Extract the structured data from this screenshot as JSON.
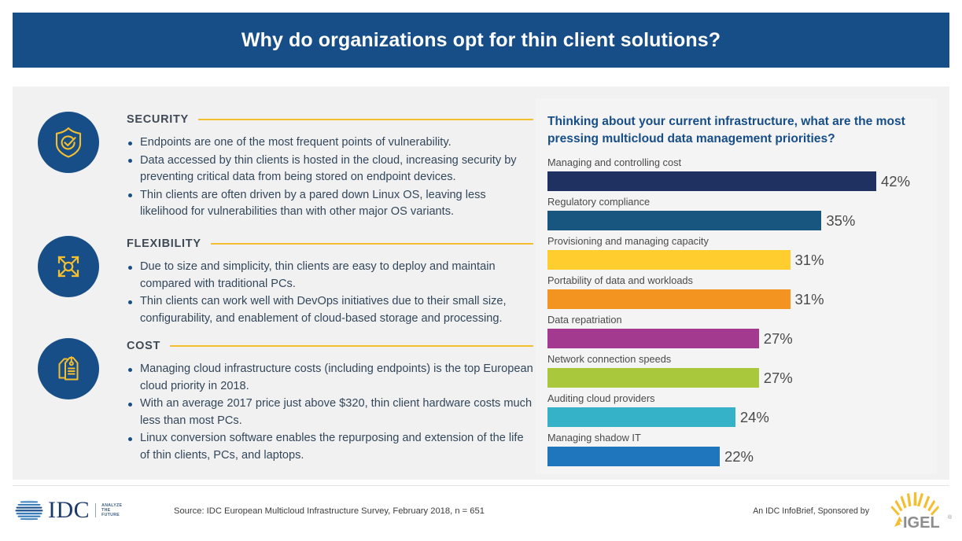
{
  "header": {
    "title": "Why do organizations opt for thin client solutions?"
  },
  "sections": [
    {
      "id": "security",
      "title": "SECURITY",
      "icon": "shield-check-icon",
      "bullets": [
        "Endpoints are one of the most frequent points of vulnerability.",
        "Data accessed by thin clients is hosted in the cloud, increasing security by preventing critical data from being stored on endpoint devices.",
        "Thin clients are often driven by a pared down Linux OS, leaving less likelihood for vulnerabilities than with other major OS variants."
      ]
    },
    {
      "id": "flexibility",
      "title": "FLEXIBILITY",
      "icon": "expand-arrows-icon",
      "bullets": [
        "Due to size and simplicity, thin clients are easy to deploy and maintain compared with traditional PCs.",
        "Thin clients can work well with DevOps initiatives due to their small size, configurability, and enablement of cloud-based storage and processing."
      ]
    },
    {
      "id": "cost",
      "title": "COST",
      "icon": "price-tags-icon",
      "bullets": [
        "Managing cloud infrastructure costs (including endpoints) is the top European cloud priority in 2018.",
        "With an average 2017 price just above $320, thin client hardware costs much less than most PCs.",
        "Linux conversion software enables the repurposing and extension of the life of thin clients, PCs, and laptops."
      ]
    }
  ],
  "chart_data": {
    "type": "bar",
    "orientation": "horizontal",
    "title": "Thinking about your current infrastructure, what are the most pressing multicloud data management priorities?",
    "xlabel": "",
    "ylabel": "",
    "xlim": [
      0,
      42
    ],
    "grid": false,
    "legend": "none",
    "value_suffix": "%",
    "categories": [
      "Managing and controlling cost",
      "Regulatory compliance",
      "Provisioning and managing capacity",
      "Portability of data and workloads",
      "Data repatriation",
      "Network connection speeds",
      "Auditing cloud providers",
      "Managing shadow IT"
    ],
    "values": [
      42,
      35,
      31,
      31,
      27,
      27,
      24,
      22
    ],
    "value_labels": [
      "42%",
      "35%",
      "31%",
      "31%",
      "27%",
      "27%",
      "24%",
      "22%"
    ],
    "colors": [
      "#1e3160",
      "#19567f",
      "#ffcd2e",
      "#f2941f",
      "#a33a90",
      "#a9c83c",
      "#36b2c8",
      "#1f76bc"
    ]
  },
  "footer": {
    "idc_word": "IDC",
    "idc_tagline_line1": "ANALYZE",
    "idc_tagline_line2": "THE",
    "idc_tagline_line3": "FUTURE",
    "source": "Source: IDC European Multicloud Infrastructure Survey, February 2018, n = 651",
    "sponsor": "An IDC InfoBrief, Sponsored by",
    "sponsor_logo_text": "IGEL"
  },
  "colors": {
    "brand_blue": "#174E88",
    "accent_gold": "#F5BE2E",
    "panel_bg": "#f1f1f1",
    "chart_panel_bg": "#f4f4f4",
    "text_body": "#33475b"
  }
}
